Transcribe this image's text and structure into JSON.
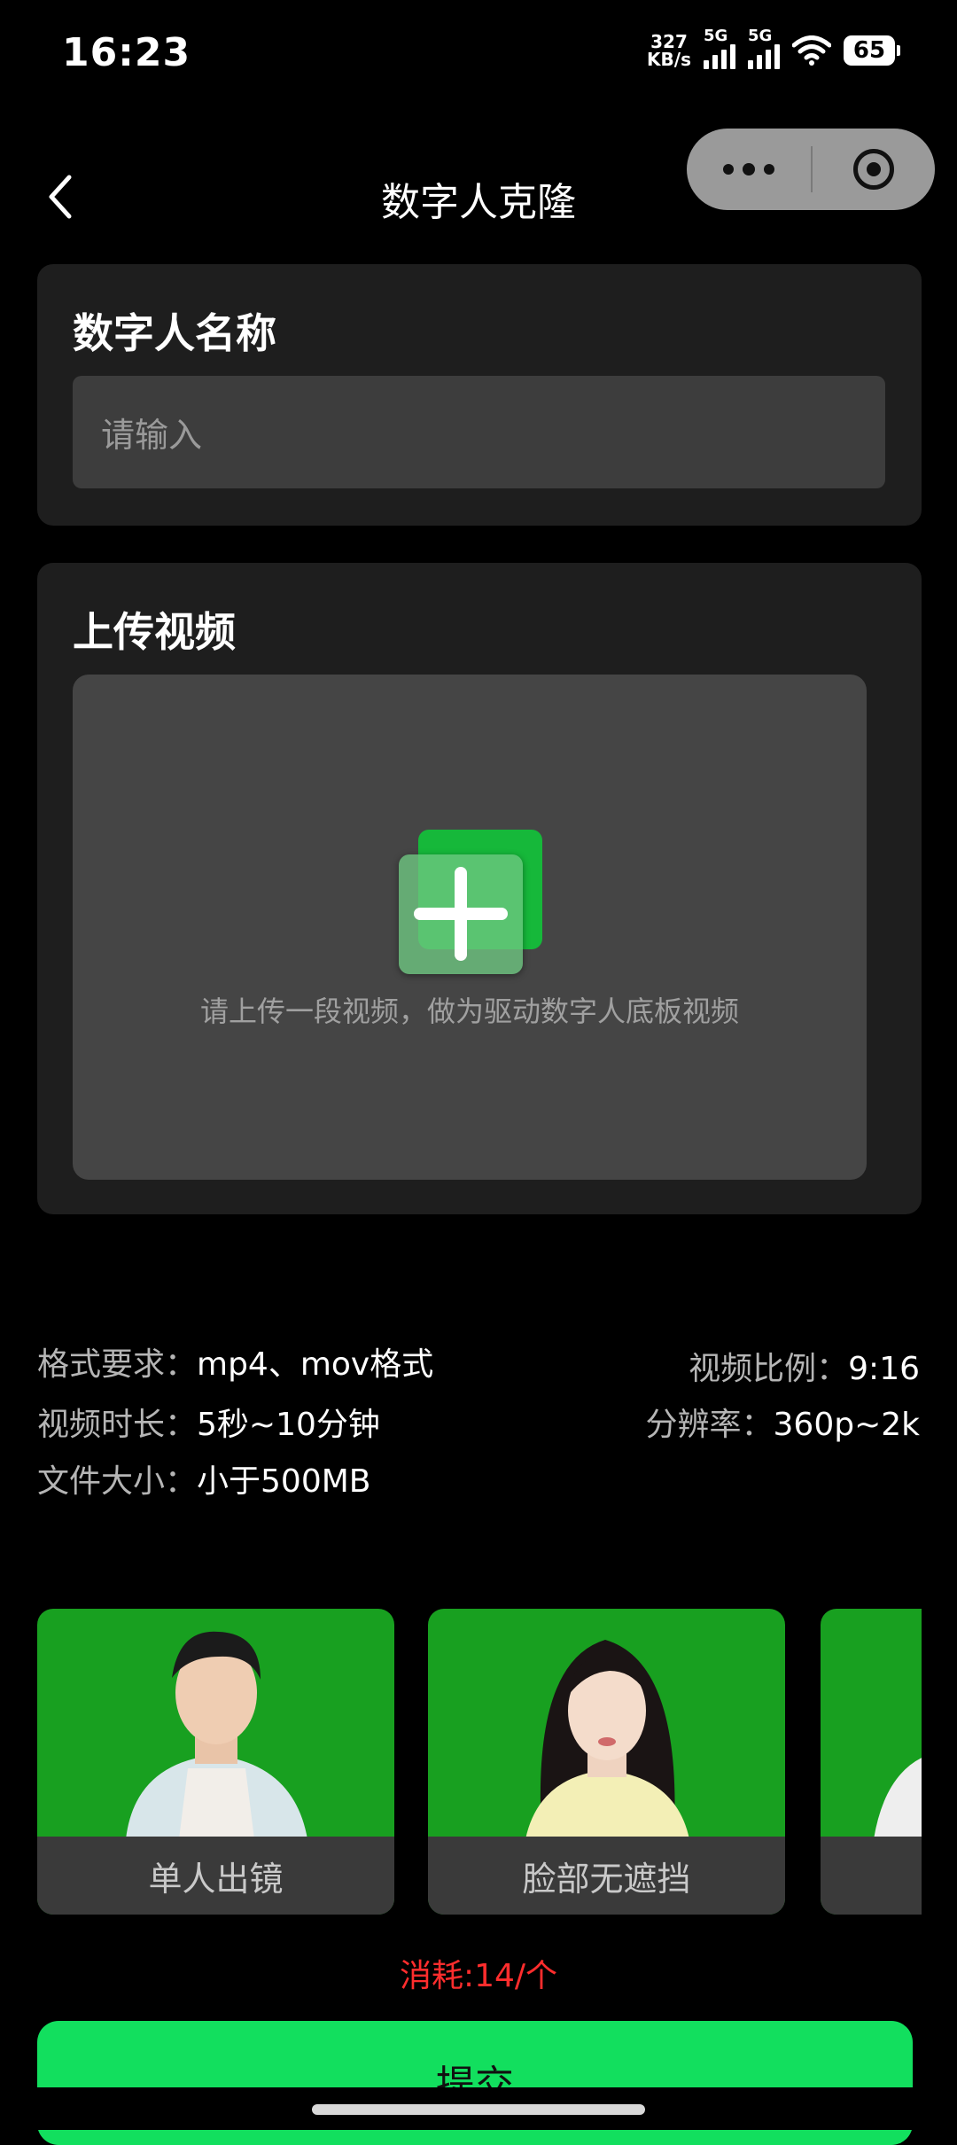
{
  "status": {
    "time": "16:23",
    "net_speed_value": "327",
    "net_speed_unit": "KB/s",
    "sim1_label": "5G",
    "sim2_label": "5G",
    "battery": "65"
  },
  "nav": {
    "title": "数字人克隆"
  },
  "name_card": {
    "heading": "数字人名称",
    "placeholder": "请输入"
  },
  "upload_card": {
    "heading": "上传视频",
    "hint": "请上传一段视频，做为驱动数字人底板视频"
  },
  "requirements": {
    "format_key": "格式要求：",
    "format_val": "mp4、mov格式",
    "ratio_key": "视频比例：",
    "ratio_val": "9:16",
    "duration_key": "视频时长：",
    "duration_val": "5秒~10分钟",
    "resolution_key": "分辨率：",
    "resolution_val": "360p~2k",
    "size_key": "文件大小：",
    "size_val": "小于500MB"
  },
  "samples": [
    {
      "caption": "单人出镜"
    },
    {
      "caption": "脸部无遮挡"
    }
  ],
  "footer": {
    "cost": "消耗:14/个",
    "submit": "提交"
  },
  "colors": {
    "accent_green": "#12df5e",
    "cost_red": "#ff2d2d",
    "chroma_green": "#18a020"
  }
}
